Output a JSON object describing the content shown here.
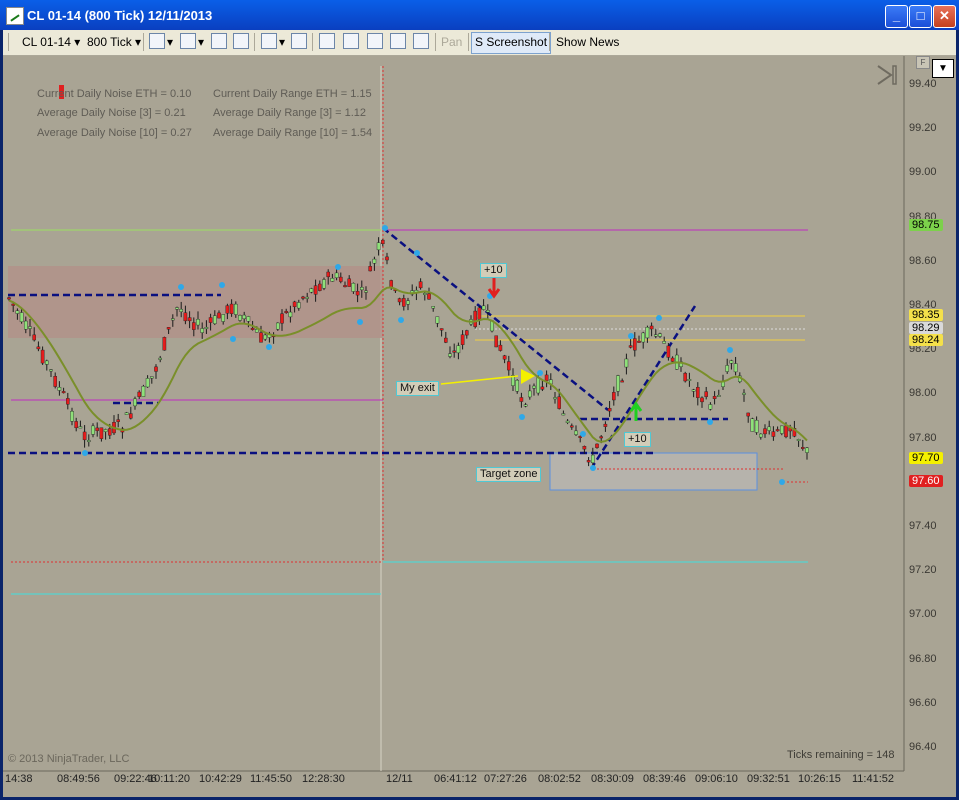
{
  "window": {
    "title": "CL 01-14 (800 Tick)  12/11/2013",
    "min": "_",
    "max": "□",
    "close": "✕"
  },
  "toolbar": {
    "instrument": "CL 01-14",
    "interval": "800 Tick",
    "pan": "Pan",
    "screenshot": "S Screenshot",
    "show_news": "Show News"
  },
  "noise_box": {
    "col1": [
      "Current Daily Noise ETH = 0.10",
      "Average Daily Noise [3] = 0.21",
      "Average Daily Noise [10] = 0.27"
    ],
    "col2": [
      "Current Daily Range ETH = 1.15",
      "Average Daily Range [3] = 1.12",
      "Average Daily Range [10] = 1.54"
    ]
  },
  "annotations": {
    "plus10_a": "+10",
    "plus10_b": "+10",
    "my_exit": "My exit",
    "target_zone": "Target zone"
  },
  "copyright": "© 2013 NinjaTrader, LLC",
  "ticks_remaining": "Ticks remaining = 148",
  "y_axis": [
    "99.40",
    "99.20",
    "99.00",
    "98.80",
    "98.60",
    "98.40",
    "98.20",
    "98.00",
    "97.80",
    "97.60",
    "97.40",
    "97.20",
    "97.00",
    "96.80",
    "96.60",
    "96.40"
  ],
  "x_axis": [
    "14:38",
    "08:49:56",
    "09:22:46",
    "10:11:20",
    "10:42:29",
    "11:45:50",
    "12:28:30",
    "12/11",
    "06:41:12",
    "07:27:26",
    "08:02:52",
    "08:30:09",
    "08:39:46",
    "09:06:10",
    "09:32:51",
    "10:26:15",
    "11:41:52"
  ],
  "price_tags": [
    {
      "label": "98.75",
      "bg": "#7CD14B",
      "fg": "#000000"
    },
    {
      "label": "98.35",
      "bg": "#F4E04A",
      "fg": "#000000"
    },
    {
      "label": "98.29",
      "bg": "#D9D9D9",
      "fg": "#000000"
    },
    {
      "label": "98.24",
      "bg": "#F4E04A",
      "fg": "#000000"
    },
    {
      "label": "97.70",
      "bg": "#F4F000",
      "fg": "#000000"
    },
    {
      "label": "97.60",
      "bg": "#E02020",
      "fg": "#ffffff"
    }
  ],
  "colors": {
    "chart_bg": "#A9A494",
    "up_candle": "#8FE07A",
    "down_candle": "#E41C1C",
    "sma": "#7A8F2A",
    "dashed_navy": "#0A1080",
    "pivot_dot": "#2FA8E8"
  }
}
